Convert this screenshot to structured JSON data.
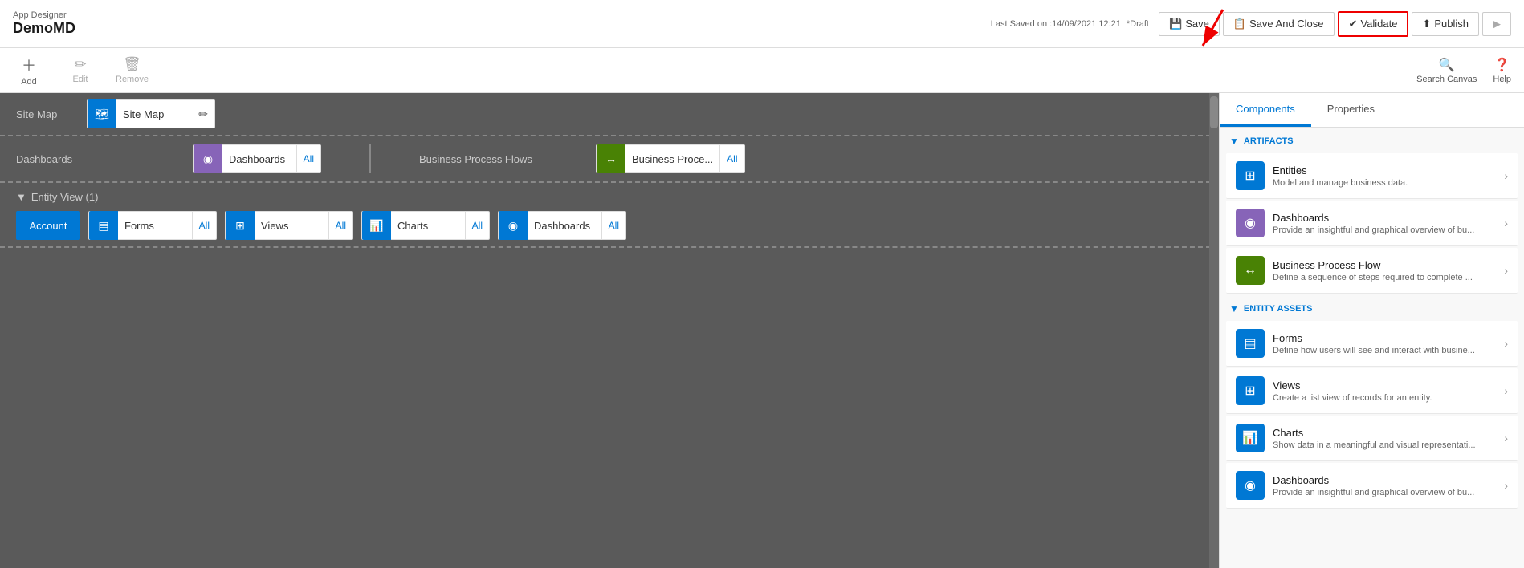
{
  "header": {
    "app_designer_label": "App Designer",
    "app_name": "DemoMD",
    "save_info": "Last Saved on :14/09/2021 12:21",
    "draft_label": "*Draft",
    "save_btn": "Save",
    "save_close_btn": "Save And Close",
    "validate_btn": "Validate",
    "publish_btn": "Publish"
  },
  "toolbar": {
    "add_label": "Add",
    "edit_label": "Edit",
    "remove_label": "Remove",
    "search_canvas_label": "Search Canvas",
    "help_label": "Help"
  },
  "canvas": {
    "sitemap_label": "Site Map",
    "sitemap_comp": "Site Map",
    "dashboards_label": "Dashboards",
    "dashboards_comp": "Dashboards",
    "dashboards_all": "All",
    "bpf_label": "Business Process Flows",
    "bpf_comp": "Business Proce...",
    "bpf_all": "All",
    "entity_view_label": "Entity View (1)",
    "account_label": "Account",
    "forms_comp": "Forms",
    "forms_all": "All",
    "views_comp": "Views",
    "views_all": "All",
    "charts_comp": "Charts",
    "charts_all": "All",
    "entity_dashboards_comp": "Dashboards",
    "entity_dashboards_all": "All"
  },
  "right_panel": {
    "components_tab": "Components",
    "properties_tab": "Properties",
    "artifacts_label": "ARTIFACTS",
    "entity_assets_label": "ENTITY ASSETS",
    "items": [
      {
        "id": "entities",
        "icon": "blue",
        "icon_char": "⊞",
        "title": "Entities",
        "desc": "Model and manage business data."
      },
      {
        "id": "dashboards",
        "icon": "purple",
        "icon_char": "◉",
        "title": "Dashboards",
        "desc": "Provide an insightful and graphical overview of bu..."
      },
      {
        "id": "bpf",
        "icon": "green",
        "icon_char": "↔",
        "title": "Business Process Flow",
        "desc": "Define a sequence of steps required to complete ..."
      }
    ],
    "entity_items": [
      {
        "id": "forms",
        "icon": "blue",
        "icon_char": "▤",
        "title": "Forms",
        "desc": "Define how users will see and interact with busine..."
      },
      {
        "id": "views",
        "icon": "blue",
        "icon_char": "⊞",
        "title": "Views",
        "desc": "Create a list view of records for an entity."
      },
      {
        "id": "charts",
        "icon": "blue",
        "icon_char": "📊",
        "title": "Charts",
        "desc": "Show data in a meaningful and visual representati..."
      },
      {
        "id": "entity-dashboards",
        "icon": "blue",
        "icon_char": "◉",
        "title": "Dashboards",
        "desc": "Provide an insightful and graphical overview of bu..."
      }
    ]
  }
}
